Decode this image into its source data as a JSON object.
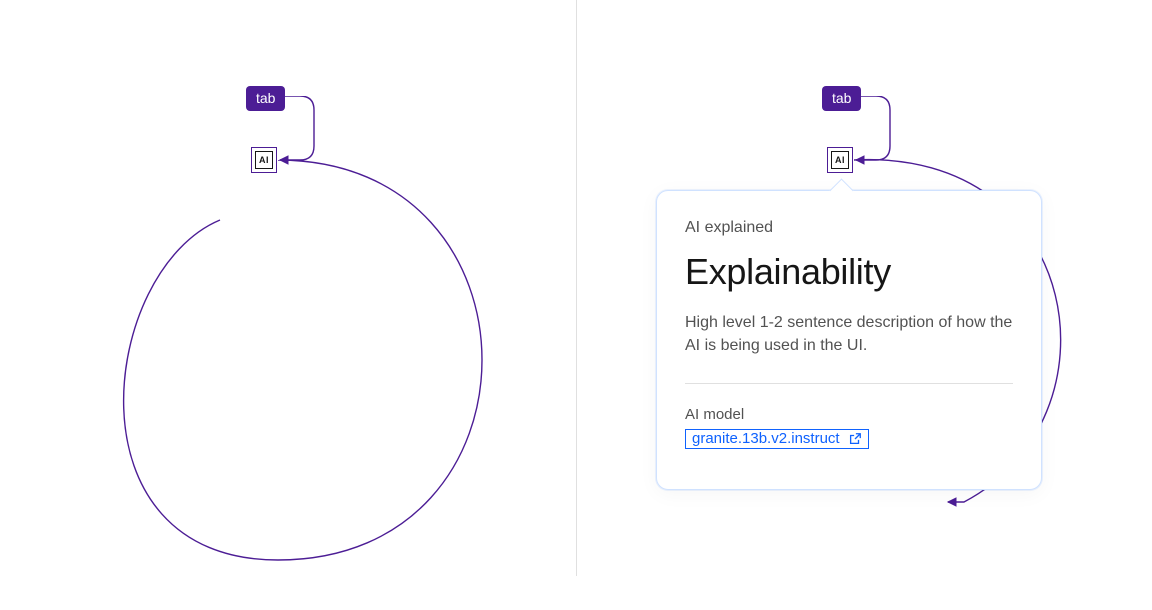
{
  "panels": {
    "left": {
      "tab_label": "tab",
      "ai_label": "AI"
    },
    "right": {
      "tab_label": "tab",
      "ai_label": "AI",
      "popover": {
        "eyebrow": "AI explained",
        "title": "Explainability",
        "description": "High level 1-2 sentence description of how the AI is being used in the UI.",
        "model_label": "AI model",
        "model_name": "granite.13b.v2.instruct"
      }
    }
  },
  "colors": {
    "purple": "#4c1d95",
    "link": "#0f62fe"
  }
}
